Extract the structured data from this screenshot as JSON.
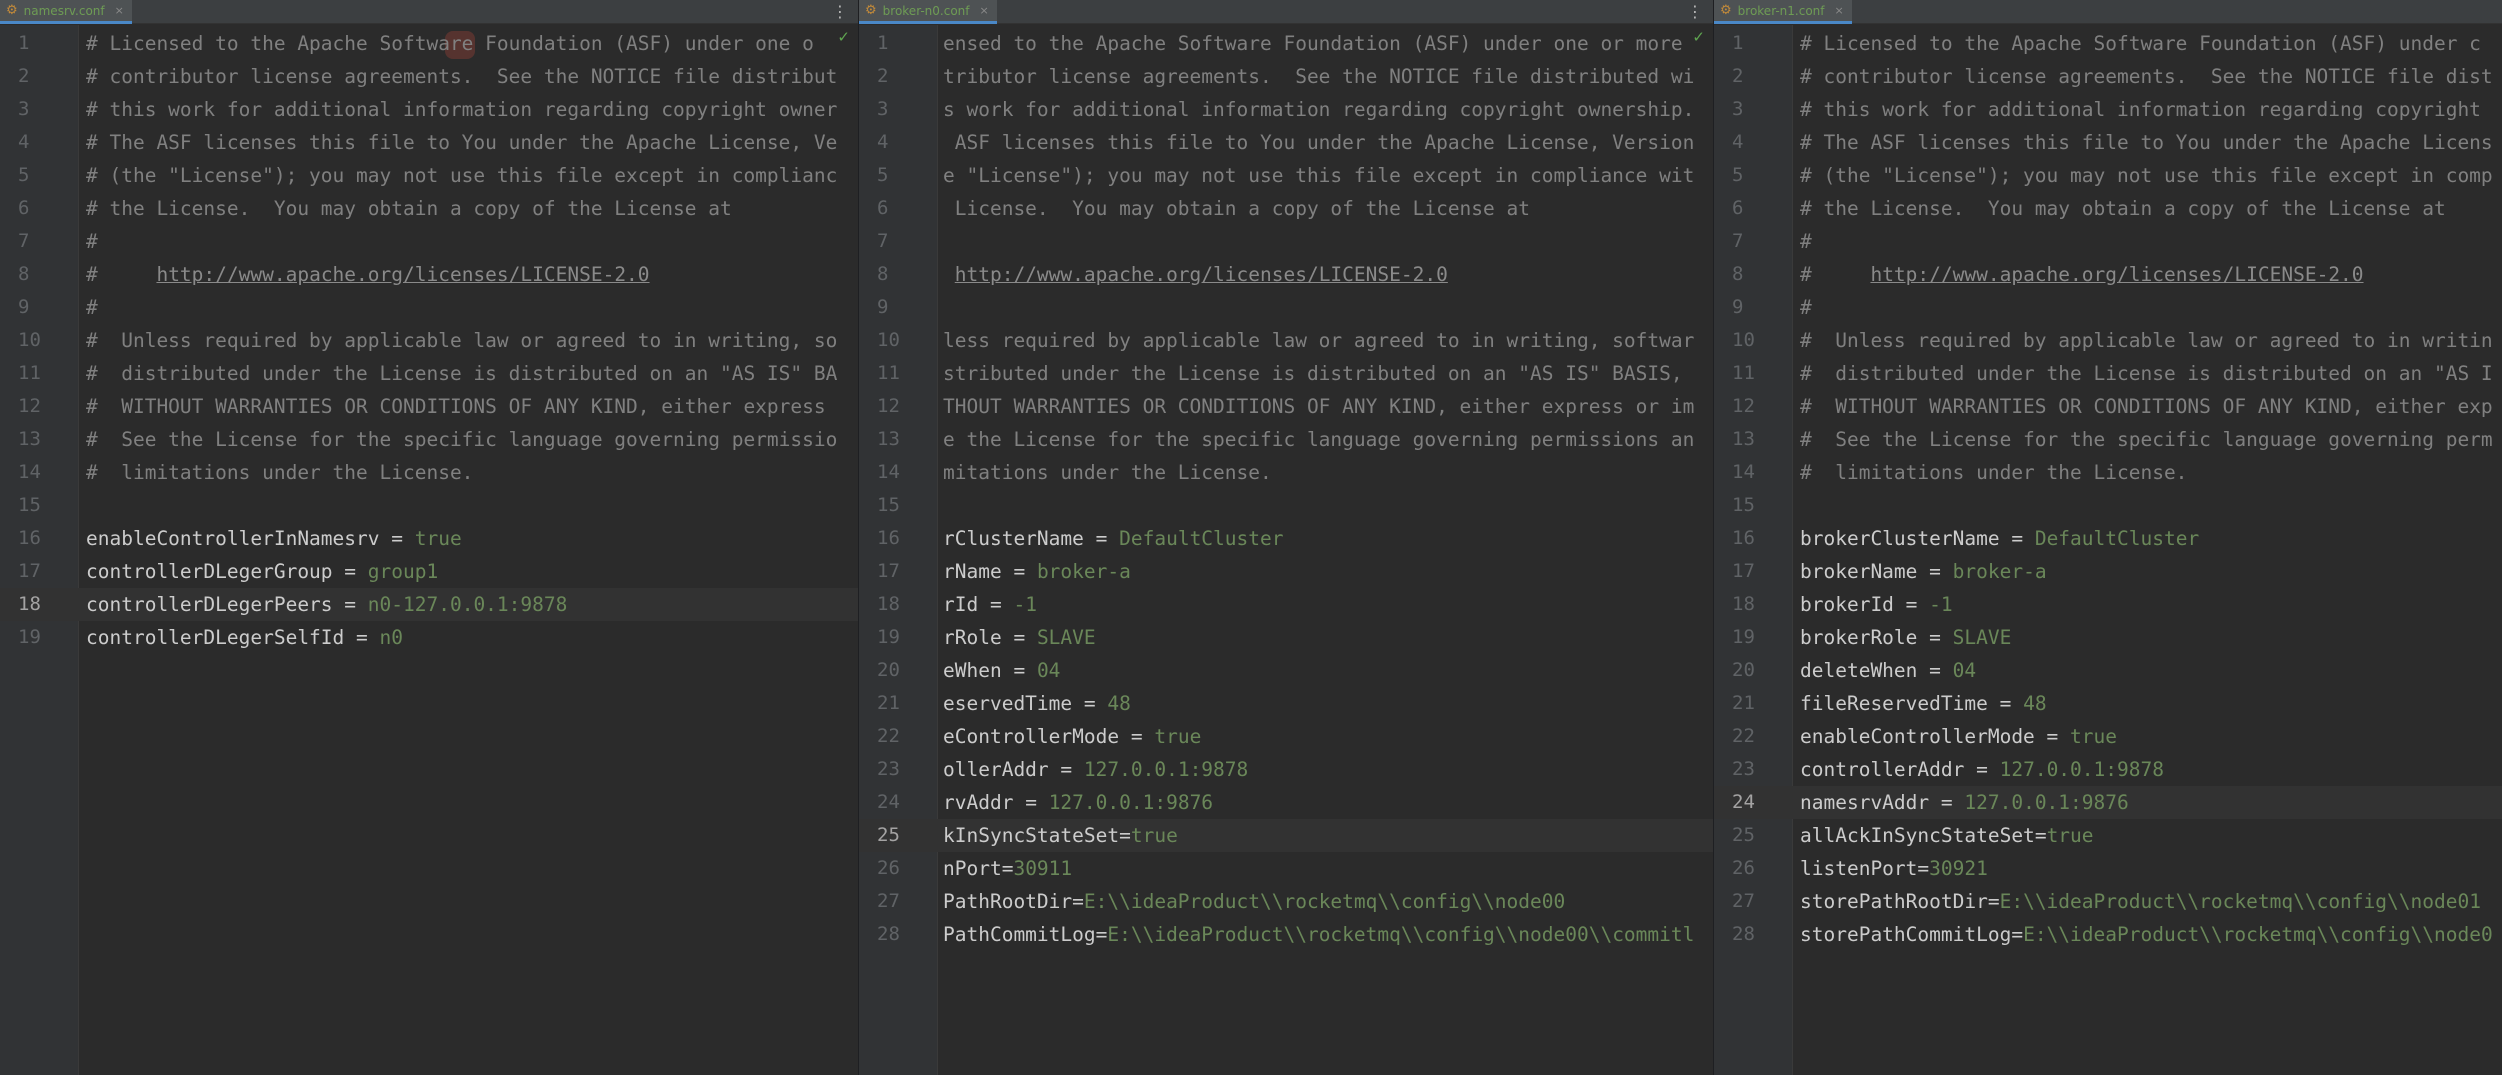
{
  "panes": [
    {
      "tab": "namesrv.conf",
      "current_line": 18,
      "lines": [
        {
          "n": "1",
          "c": "# Licensed to the Apache Software Foundation (ASF) under one o"
        },
        {
          "n": "2",
          "c": "# contributor license agreements.  See the NOTICE file distribut"
        },
        {
          "n": "3",
          "c": "# this work for additional information regarding copyright owner"
        },
        {
          "n": "4",
          "c": "# The ASF licenses this file to You under the Apache License, Ve"
        },
        {
          "n": "5",
          "c": "# (the \"License\"); you may not use this file except in complianc"
        },
        {
          "n": "6",
          "c": "# the License.  You may obtain a copy of the License at"
        },
        {
          "n": "7",
          "c": "#"
        },
        {
          "n": "8",
          "c": "#     ",
          "link": "http://www.apache.org/licenses/LICENSE-2.0"
        },
        {
          "n": "9",
          "c": "#"
        },
        {
          "n": "10",
          "c": "#  Unless required by applicable law or agreed to in writing, so"
        },
        {
          "n": "11",
          "c": "#  distributed under the License is distributed on an \"AS IS\" BA"
        },
        {
          "n": "12",
          "c": "#  WITHOUT WARRANTIES OR CONDITIONS OF ANY KIND, either express "
        },
        {
          "n": "13",
          "c": "#  See the License for the specific language governing permissio"
        },
        {
          "n": "14",
          "c": "#  limitations under the License."
        },
        {
          "n": "15",
          "c": ""
        },
        {
          "n": "16",
          "k": "enableControllerInNamesrv",
          "op": " = ",
          "v": "true"
        },
        {
          "n": "17",
          "k": "controllerDLegerGroup",
          "op": " = ",
          "v": "group1"
        },
        {
          "n": "18",
          "k": "controllerDLegerPeers",
          "op": " = ",
          "v": "n0-127.0.0.1:9878"
        },
        {
          "n": "19",
          "k": "controllerDLegerSelfId",
          "op": " = ",
          "v": "n0"
        }
      ]
    },
    {
      "tab": "broker-n0.conf",
      "current_line": 25,
      "lines": [
        {
          "n": "1",
          "c": "ensed to the Apache Software Foundation (ASF) under one or more"
        },
        {
          "n": "2",
          "c": "tributor license agreements.  See the NOTICE file distributed wi"
        },
        {
          "n": "3",
          "c": "s work for additional information regarding copyright ownership."
        },
        {
          "n": "4",
          "c": " ASF licenses this file to You under the Apache License, Version"
        },
        {
          "n": "5",
          "c": "e \"License\"); you may not use this file except in compliance wit"
        },
        {
          "n": "6",
          "c": " License.  You may obtain a copy of the License at"
        },
        {
          "n": "7",
          "c": ""
        },
        {
          "n": "8",
          "c": " ",
          "link": "http://www.apache.org/licenses/LICENSE-2.0"
        },
        {
          "n": "9",
          "c": ""
        },
        {
          "n": "10",
          "c": "less required by applicable law or agreed to in writing, softwar"
        },
        {
          "n": "11",
          "c": "stributed under the License is distributed on an \"AS IS\" BASIS,"
        },
        {
          "n": "12",
          "c": "THOUT WARRANTIES OR CONDITIONS OF ANY KIND, either express or im"
        },
        {
          "n": "13",
          "c": "e the License for the specific language governing permissions an"
        },
        {
          "n": "14",
          "c": "mitations under the License."
        },
        {
          "n": "15",
          "c": ""
        },
        {
          "n": "16",
          "k": "rClusterName",
          "op": " = ",
          "v": "DefaultCluster"
        },
        {
          "n": "17",
          "k": "rName",
          "op": " = ",
          "v": "broker-a"
        },
        {
          "n": "18",
          "k": "rId",
          "op": " = ",
          "v": "-1"
        },
        {
          "n": "19",
          "k": "rRole",
          "op": " = ",
          "v": "SLAVE"
        },
        {
          "n": "20",
          "k": "eWhen",
          "op": " = ",
          "v": "04"
        },
        {
          "n": "21",
          "k": "eservedTime",
          "op": " = ",
          "v": "48"
        },
        {
          "n": "22",
          "k": "eControllerMode",
          "op": " = ",
          "v": "true"
        },
        {
          "n": "23",
          "k": "ollerAddr",
          "op": " = ",
          "v": "127.0.0.1:9878"
        },
        {
          "n": "24",
          "k": "rvAddr",
          "op": " = ",
          "v": "127.0.0.1:9876"
        },
        {
          "n": "25",
          "k": "kInSyncStateSet",
          "op": "=",
          "v": "true"
        },
        {
          "n": "26",
          "k": "nPort",
          "op": "=",
          "v": "30911"
        },
        {
          "n": "27",
          "k": "PathRootDir",
          "op": "=",
          "v": "E:\\\\ideaProduct\\\\rocketmq\\\\config\\\\node00"
        },
        {
          "n": "28",
          "k": "PathCommitLog",
          "op": "=",
          "v": "E:\\\\ideaProduct\\\\rocketmq\\\\config\\\\node00\\\\commitl"
        }
      ]
    },
    {
      "tab": "broker-n1.conf",
      "current_line": 24,
      "lines": [
        {
          "n": "1",
          "c": "# Licensed to the Apache Software Foundation (ASF) under c"
        },
        {
          "n": "2",
          "c": "# contributor license agreements.  See the NOTICE file dist"
        },
        {
          "n": "3",
          "c": "# this work for additional information regarding copyright"
        },
        {
          "n": "4",
          "c": "# The ASF licenses this file to You under the Apache Licens"
        },
        {
          "n": "5",
          "c": "# (the \"License\"); you may not use this file except in comp"
        },
        {
          "n": "6",
          "c": "# the License.  You may obtain a copy of the License at"
        },
        {
          "n": "7",
          "c": "#"
        },
        {
          "n": "8",
          "c": "#     ",
          "link": "http://www.apache.org/licenses/LICENSE-2.0"
        },
        {
          "n": "9",
          "c": "#"
        },
        {
          "n": "10",
          "c": "#  Unless required by applicable law or agreed to in writin"
        },
        {
          "n": "11",
          "c": "#  distributed under the License is distributed on an \"AS I"
        },
        {
          "n": "12",
          "c": "#  WITHOUT WARRANTIES OR CONDITIONS OF ANY KIND, either exp"
        },
        {
          "n": "13",
          "c": "#  See the License for the specific language governing perm"
        },
        {
          "n": "14",
          "c": "#  limitations under the License."
        },
        {
          "n": "15",
          "c": ""
        },
        {
          "n": "16",
          "k": "brokerClusterName",
          "op": " = ",
          "v": "DefaultCluster"
        },
        {
          "n": "17",
          "k": "brokerName",
          "op": " = ",
          "v": "broker-a"
        },
        {
          "n": "18",
          "k": "brokerId",
          "op": " = ",
          "v": "-1"
        },
        {
          "n": "19",
          "k": "brokerRole",
          "op": " = ",
          "v": "SLAVE"
        },
        {
          "n": "20",
          "k": "deleteWhen",
          "op": " = ",
          "v": "04"
        },
        {
          "n": "21",
          "k": "fileReservedTime",
          "op": " = ",
          "v": "48"
        },
        {
          "n": "22",
          "k": "enableControllerMode",
          "op": " = ",
          "v": "true"
        },
        {
          "n": "23",
          "k": "controllerAddr",
          "op": " = ",
          "v": "127.0.0.1:9878"
        },
        {
          "n": "24",
          "k": "namesrvAddr",
          "op": " = ",
          "v": "127.0.0.1:9876"
        },
        {
          "n": "25",
          "k": "allAckInSyncStateSet",
          "op": "=",
          "v": "true"
        },
        {
          "n": "26",
          "k": "listenPort",
          "op": "=",
          "v": "30921"
        },
        {
          "n": "27",
          "k": "storePathRootDir",
          "op": "=",
          "v": "E:\\\\ideaProduct\\\\rocketmq\\\\config\\\\node01"
        },
        {
          "n": "28",
          "k": "storePathCommitLog",
          "op": "=",
          "v": "E:\\\\ideaProduct\\\\rocketmq\\\\config\\\\node0"
        }
      ]
    }
  ],
  "icons": {
    "file": "properties-file-icon",
    "close": "close-icon",
    "more": "more-options-icon",
    "check": "inspection-ok-icon"
  },
  "glyphs": {
    "close": "×",
    "more": "⋮",
    "check": "✓",
    "file": "⚙"
  }
}
